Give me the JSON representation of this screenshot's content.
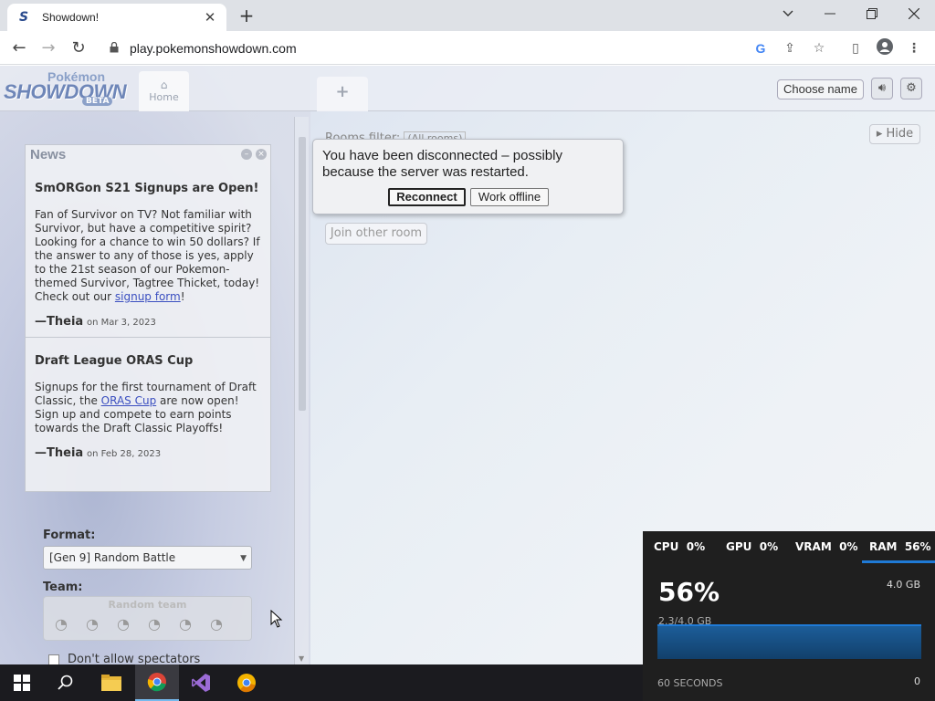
{
  "browser": {
    "tab_title": "Showdown!",
    "tab_close": "✕",
    "new_tab": "+",
    "url": "play.pokemonshowdown.com"
  },
  "ps": {
    "logo_top": "Pokémon",
    "logo_main": "SHOWDOWN",
    "logo_beta": "BETA",
    "home_tab": "Home",
    "new_tab": "+",
    "choose_name": "Choose name"
  },
  "news": {
    "title": "News",
    "items": [
      {
        "heading": "SmORGon S21 Signups are Open!",
        "body": "Fan of Survivor on TV? Not familiar with Survivor, but have a competitive spirit? Looking for a chance to win 50 dollars? If the answer to any of those is yes, apply to the 21st season of our Pokemon-themed Survivor, Tagtree Thicket, today! Check out our ",
        "link": "signup form",
        "after": "!",
        "author": "—Theia",
        "date": "on Mar 3, 2023"
      },
      {
        "heading": "Draft League ORAS Cup",
        "body": "Signups for the first tournament of Draft Classic, the ",
        "link": "ORAS Cup",
        "after": " are now open! Sign up and compete to earn points towards the Draft Classic Playoffs!",
        "author": "—Theia",
        "date": "on Feb 28, 2023"
      }
    ]
  },
  "battle": {
    "format_label": "Format:",
    "format_value": "[Gen 9] Random Battle",
    "team_label": "Team:",
    "team_value": "Random team",
    "spectators": "Don't allow spectators"
  },
  "rooms": {
    "filter_label": "Rooms filter:",
    "filter_value": "(All rooms)",
    "hide": "Hide",
    "join_other": "Join other room"
  },
  "popup": {
    "message": "You have been disconnected – possibly because the server was restarted.",
    "reconnect": "Reconnect",
    "work_offline": "Work offline"
  },
  "perf": {
    "cpu": "CPU",
    "cpu_val": "0%",
    "gpu": "GPU",
    "gpu_val": "0%",
    "vram": "VRAM",
    "vram_val": "0%",
    "ram": "RAM",
    "ram_val": "56%",
    "big": "56%",
    "capacity": "4.0 GB",
    "used": "2.3/4.0 GB",
    "time": "60 SECONDS",
    "zero": "0",
    "accent": "#1f7ad6"
  }
}
